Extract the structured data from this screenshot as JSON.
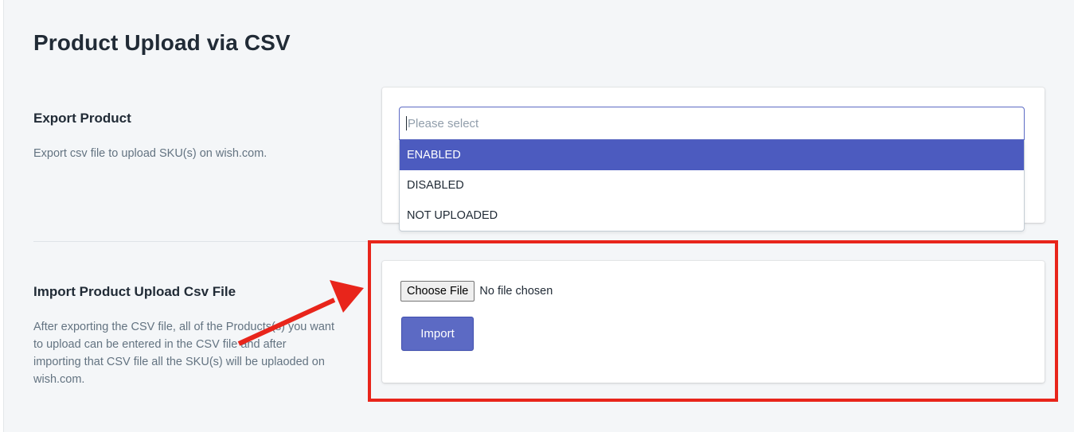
{
  "page": {
    "title": "Product Upload via CSV"
  },
  "export": {
    "title": "Export Product",
    "description": "Export csv file to upload SKU(s) on wish.com.",
    "select": {
      "placeholder": "Please select",
      "options": [
        "ENABLED",
        "DISABLED",
        "NOT UPLOADED"
      ],
      "highlighted": "ENABLED"
    }
  },
  "import": {
    "title": "Import Product Upload Csv File",
    "description": "After exporting the CSV file, all of the Products(s) you want to upload can be entered in the CSV file and after importing that CSV file all the SKU(s) will be uplaoded on wish.com.",
    "choose_file_label": "Choose File",
    "file_status": "No file chosen",
    "import_label": "Import"
  },
  "annotation": {
    "highlight_color": "#e8251b",
    "arrow_color": "#e8251b"
  },
  "colors": {
    "accent": "#5c6ac4",
    "selected_option": "#4c5bbf",
    "background": "#f4f6f8"
  }
}
